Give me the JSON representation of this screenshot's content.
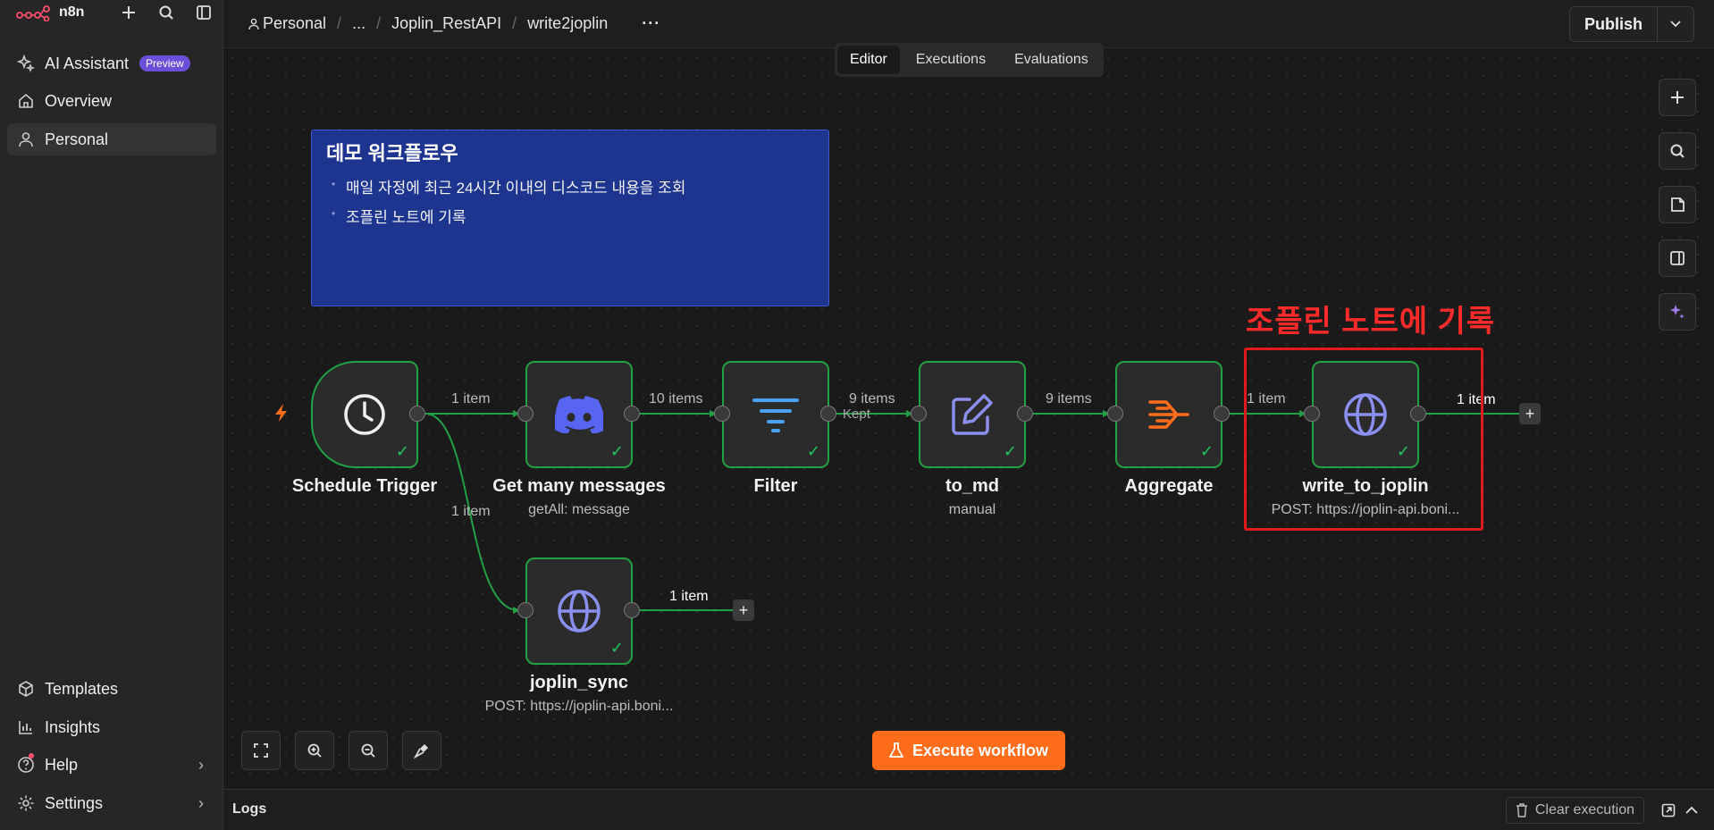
{
  "brand": {
    "name": "n8n"
  },
  "sidebar": {
    "items": [
      {
        "label": "AI Assistant",
        "badge": "Preview",
        "icon": "sparkle-icon"
      },
      {
        "label": "Overview",
        "icon": "home-icon"
      },
      {
        "label": "Personal",
        "icon": "user-icon"
      }
    ],
    "bottom_items": [
      {
        "label": "Templates",
        "icon": "box-icon"
      },
      {
        "label": "Insights",
        "icon": "chart-icon"
      },
      {
        "label": "Help",
        "icon": "help-icon"
      },
      {
        "label": "Settings",
        "icon": "gear-icon"
      }
    ]
  },
  "breadcrumb": {
    "project": "Personal",
    "ellipsis": "...",
    "folder": "Joplin_RestAPI",
    "workflow": "write2joplin",
    "more": "···"
  },
  "publish": {
    "label": "Publish"
  },
  "tabs": [
    {
      "label": "Editor",
      "active": true
    },
    {
      "label": "Executions",
      "active": false
    },
    {
      "label": "Evaluations",
      "active": false
    }
  ],
  "sticky": {
    "title": "데모 워크플로우",
    "items": [
      "매일 자정에 최근 24시간 이내의 디스코드 내용을 조회",
      "조플린 노트에 기록"
    ]
  },
  "annotation": "조플린 노트에 기록",
  "nodes": [
    {
      "name": "Schedule Trigger",
      "subtitle": "",
      "icon": "clock-icon"
    },
    {
      "name": "Get many messages",
      "subtitle": "getAll: message",
      "icon": "discord-icon"
    },
    {
      "name": "Filter",
      "subtitle": "",
      "icon": "filter-icon"
    },
    {
      "name": "to_md",
      "subtitle": "manual",
      "icon": "edit-icon"
    },
    {
      "name": "Aggregate",
      "subtitle": "",
      "icon": "aggregate-icon"
    },
    {
      "name": "write_to_joplin",
      "subtitle": "POST: https://joplin-api.boni...",
      "icon": "globe-icon"
    },
    {
      "name": "joplin_sync",
      "subtitle": "POST: https://joplin-api.boni...",
      "icon": "globe-icon"
    }
  ],
  "edges": {
    "e1": "1 item",
    "e2": "10 items",
    "e3": "9 items",
    "e3_kept": "Kept",
    "e4": "9 items",
    "e5": "1 item",
    "e6": "1 item",
    "e7": "1 item",
    "e8": "1 item"
  },
  "execute": {
    "label": "Execute workflow"
  },
  "logs": {
    "title": "Logs",
    "clear_label": "Clear execution"
  },
  "colors": {
    "accent": "#ff6d1a",
    "success": "#22a046",
    "sticky": "#1e3590",
    "highlight": "#e01b1b"
  }
}
